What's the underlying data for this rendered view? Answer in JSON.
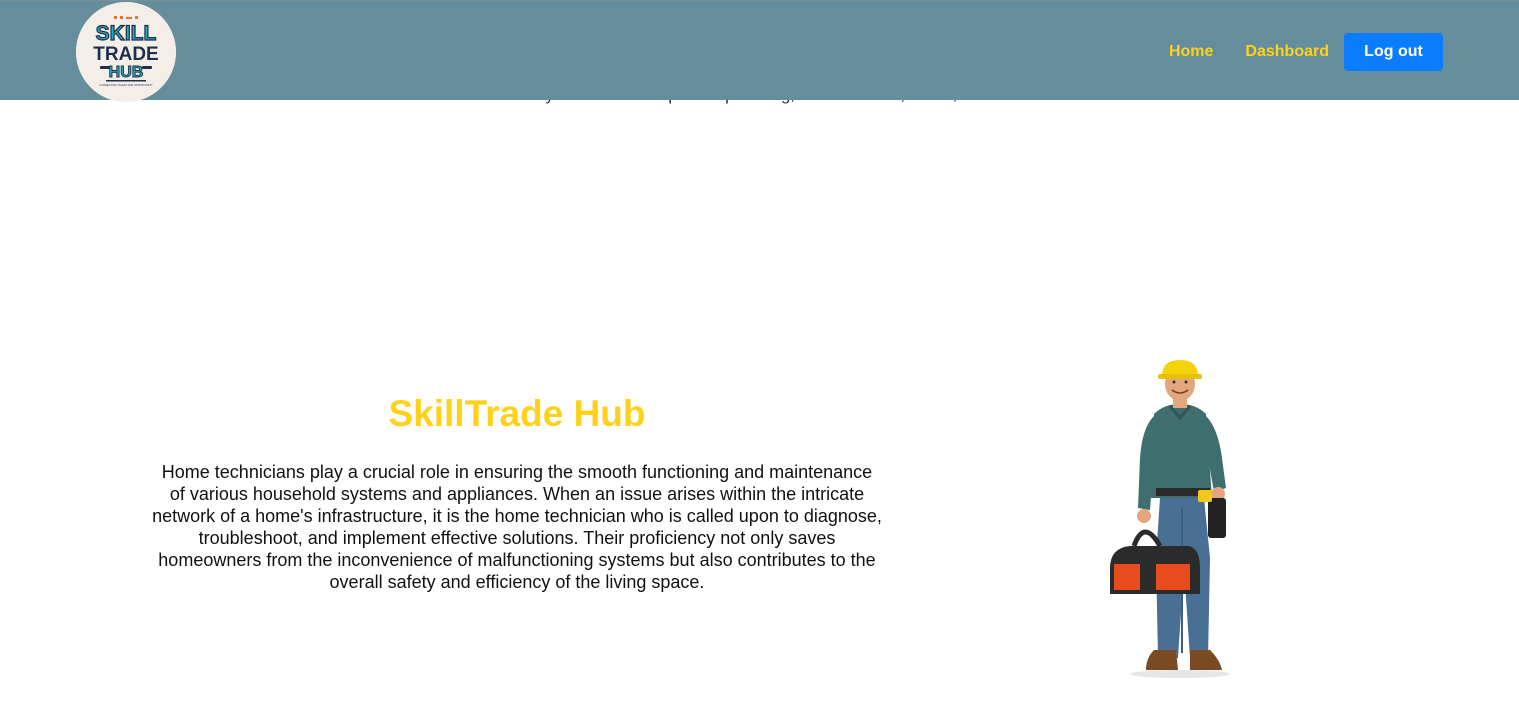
{
  "header": {
    "logo": {
      "line1": "SKILL",
      "line2": "TRADE",
      "line3": "HUB",
      "tagline": "CONNECTING TALENT AND OPPORTUNITY",
      "colors": {
        "navy": "#1e2f4a",
        "teal": "#2aa7b8",
        "orange": "#e8732a",
        "cream": "#f3efe8"
      }
    },
    "nav": {
      "home": "Home",
      "dashboard": "Dashboard",
      "logout": "Log out"
    },
    "colors": {
      "background": "#668d9c",
      "nav_link": "#ffd21a",
      "logout_button": "#0a7cff"
    }
  },
  "intro": {
    "tagline": "Efficiently connect with experts in plumbing, electrical work, HVAC, and more."
  },
  "hero": {
    "title": "SkillTrade Hub",
    "description": "Home technicians play a crucial role in ensuring the smooth functioning and maintenance of various household systems and appliances. When an issue arises within the intricate network of a home's infrastructure, it is the home technician who is called upon to diagnose, troubleshoot, and implement effective solutions. Their proficiency not only saves homeowners from the inconvenience of malfunctioning systems but also contributes to the overall safety and efficiency of the living space.",
    "image": "technician-illustration",
    "colors": {
      "title": "#ffd21a",
      "text": "#111111"
    }
  }
}
